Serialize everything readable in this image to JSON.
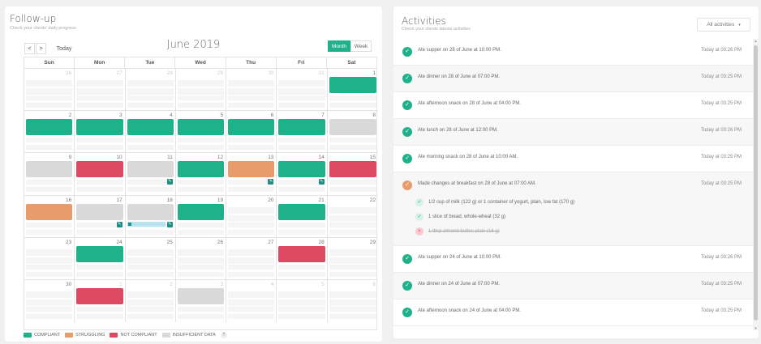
{
  "followup": {
    "title": "Follow-up",
    "subtitle": "Check your clients' daily progress",
    "prev_label": "<",
    "next_label": ">",
    "today_label": "Today",
    "month_label": "June 2019",
    "view_month": "Month",
    "view_week": "Week"
  },
  "calendar": {
    "weekdays": [
      "Sun",
      "Mon",
      "Tue",
      "Wed",
      "Thu",
      "Fri",
      "Sat"
    ],
    "statuses": {
      "compliant": "#1fb28a",
      "struggling": "#e99c6b",
      "not_compliant": "#dc4a62",
      "insufficient": "#d9d9d9"
    },
    "weeks": [
      [
        {
          "d": "26",
          "dim": true
        },
        {
          "d": "27",
          "dim": true
        },
        {
          "d": "28",
          "dim": true
        },
        {
          "d": "29",
          "dim": true
        },
        {
          "d": "30",
          "dim": true
        },
        {
          "d": "31",
          "dim": true
        },
        {
          "d": "1",
          "s": "compliant"
        }
      ],
      [
        {
          "d": "2",
          "s": "compliant"
        },
        {
          "d": "3",
          "s": "compliant"
        },
        {
          "d": "4",
          "s": "compliant"
        },
        {
          "d": "5",
          "s": "compliant"
        },
        {
          "d": "6",
          "s": "compliant"
        },
        {
          "d": "7",
          "s": "compliant"
        },
        {
          "d": "8",
          "s": "insufficient"
        }
      ],
      [
        {
          "d": "9",
          "s": "insufficient"
        },
        {
          "d": "10",
          "s": "not_compliant"
        },
        {
          "d": "11",
          "s": "insufficient",
          "edit": true
        },
        {
          "d": "12",
          "s": "compliant"
        },
        {
          "d": "13",
          "s": "struggling",
          "edit": true
        },
        {
          "d": "14",
          "s": "compliant",
          "edit": true
        },
        {
          "d": "15",
          "s": "not_compliant"
        }
      ],
      [
        {
          "d": "16",
          "s": "struggling"
        },
        {
          "d": "17",
          "s": "insufficient",
          "edit": true
        },
        {
          "d": "18",
          "s": "insufficient",
          "edit": true,
          "progress": true
        },
        {
          "d": "19",
          "s": "compliant"
        },
        {
          "d": "20"
        },
        {
          "d": "21",
          "s": "compliant"
        },
        {
          "d": "22"
        }
      ],
      [
        {
          "d": "23"
        },
        {
          "d": "24",
          "s": "compliant"
        },
        {
          "d": "25"
        },
        {
          "d": "26"
        },
        {
          "d": "27"
        },
        {
          "d": "28",
          "s": "not_compliant"
        },
        {
          "d": "29"
        }
      ],
      [
        {
          "d": "30"
        },
        {
          "d": "1",
          "dim": true,
          "s": "not_compliant"
        },
        {
          "d": "2",
          "dim": true
        },
        {
          "d": "3",
          "dim": true,
          "s": "insufficient"
        },
        {
          "d": "4",
          "dim": true
        },
        {
          "d": "5",
          "dim": true
        },
        {
          "d": "6",
          "dim": true
        }
      ]
    ]
  },
  "legend": {
    "compliant": "COMPLIANT",
    "struggling": "STRUGGLING",
    "not_compliant": "NOT COMPLIANT",
    "insufficient": "INSUFFICIENT DATA",
    "help": "?"
  },
  "activities": {
    "title": "Activities",
    "subtitle": "Check your clients latests activities",
    "filter_value": "All activities",
    "items": [
      {
        "text": "Ate supper on 28 of June at 10:00 PM.",
        "time": "Today at 03:26 PM",
        "status": "ok"
      },
      {
        "text": "Ate dinner on 28 of June at 07:00 PM.",
        "time": "Today at 03:25 PM",
        "status": "ok"
      },
      {
        "text": "Ate afternoon snack on 28 of June at 04:00 PM.",
        "time": "Today at 03:25 PM",
        "status": "ok"
      },
      {
        "text": "Ate lunch on 28 of June at 12:00 PM.",
        "time": "Today at 03:26 PM",
        "status": "ok"
      },
      {
        "text": "Ate morning snack on 28 of June at 10:00 AM.",
        "time": "Today at 03:25 PM",
        "status": "ok"
      },
      {
        "text": "Made changes at breakfast on 28 of June at 07:00 AM.",
        "time": "Today at 03:25 PM",
        "status": "changed",
        "subitems": [
          {
            "text": "1/2 cup of milk (122 g) or 1 container of yogurt, plain, low fat (170 g)",
            "kind": "added"
          },
          {
            "text": "1 slice of bread, whole-wheat (32 g)",
            "kind": "added"
          },
          {
            "text": "1 tbsp almond butter, plain (16 g)",
            "kind": "removed"
          }
        ]
      },
      {
        "text": "Ate supper on 24 of June at 10:00 PM.",
        "time": "Today at 03:26 PM",
        "status": "ok"
      },
      {
        "text": "Ate dinner on 24 of June at 07:00 PM.",
        "time": "Today at 03:25 PM",
        "status": "ok"
      },
      {
        "text": "Ate afternoon snack on 24 of June at 04:00 PM.",
        "time": "Today at 03:25 PM",
        "status": "ok"
      }
    ]
  }
}
